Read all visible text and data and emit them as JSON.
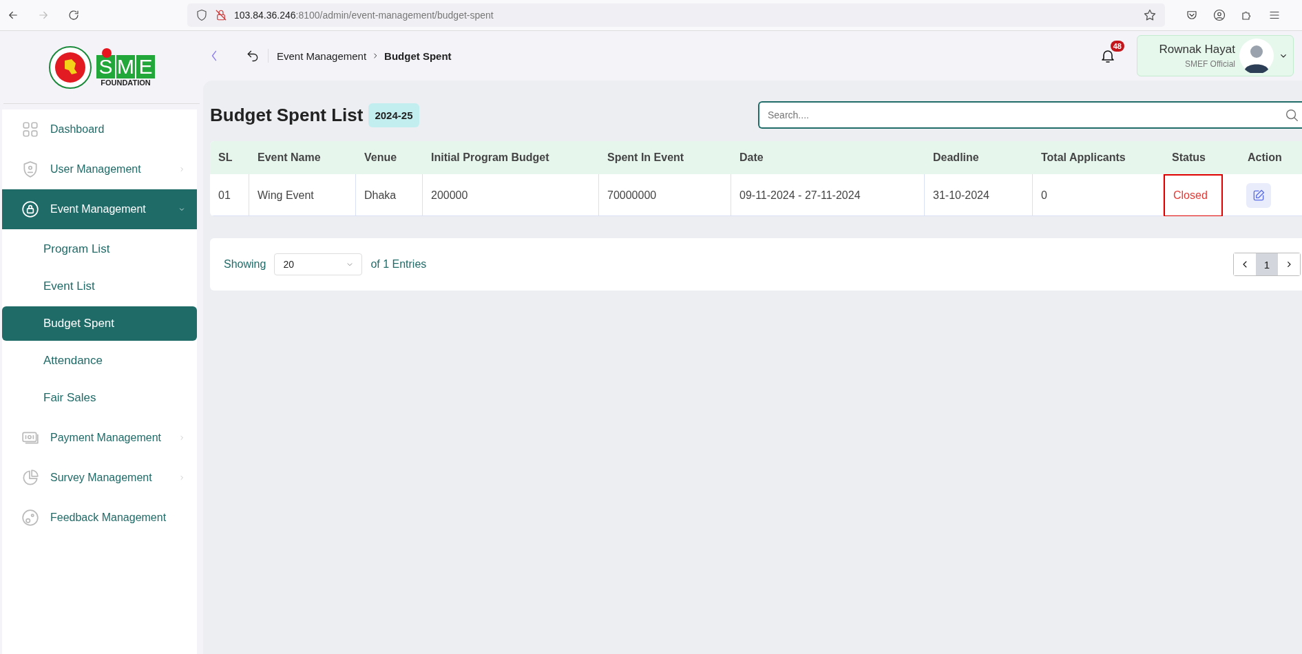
{
  "browser": {
    "url_host": "103.84.36.246",
    "url_path": ":8100/admin/event-management/budget-spent"
  },
  "logo": {
    "letters": [
      "S",
      "M",
      "E"
    ],
    "subtitle": "FOUNDATION"
  },
  "sidebar": {
    "items": [
      {
        "label": "Dashboard",
        "kind": "link",
        "selected": false
      },
      {
        "label": "User Management",
        "kind": "group",
        "selected": false,
        "expanded": false
      },
      {
        "label": "Event Management",
        "kind": "group",
        "selected": true,
        "expanded": true,
        "children": [
          {
            "label": "Program List",
            "selected": false
          },
          {
            "label": "Event List",
            "selected": false
          },
          {
            "label": "Budget Spent",
            "selected": true
          },
          {
            "label": "Attendance",
            "selected": false
          },
          {
            "label": "Fair Sales",
            "selected": false
          }
        ]
      },
      {
        "label": "Payment Management",
        "kind": "group",
        "selected": false,
        "expanded": false
      },
      {
        "label": "Survey Management",
        "kind": "group",
        "selected": false,
        "expanded": false
      },
      {
        "label": "Feedback Management",
        "kind": "link",
        "selected": false
      }
    ]
  },
  "header": {
    "breadcrumb": [
      "Event Management",
      "Budget Spent"
    ],
    "notifications": "48",
    "user": {
      "name": "Rownak Hayat",
      "role": "SMEF Official"
    }
  },
  "page": {
    "title": "Budget Spent List",
    "year_badge": "2024-25",
    "search": {
      "placeholder": "Search...."
    }
  },
  "table": {
    "columns": [
      "SL",
      "Event Name",
      "Venue",
      "Initial Program Budget",
      "Spent In Event",
      "Date",
      "Deadline",
      "Total Applicants",
      "Status",
      "Action"
    ],
    "rows": [
      {
        "cells": [
          "01",
          "Wing Event",
          "Dhaka",
          "200000",
          "70000000",
          "09-11-2024 - 27-11-2024",
          "31-10-2024",
          "0"
        ],
        "status": "Closed",
        "status_highlighted": true
      }
    ]
  },
  "pagination": {
    "showing_label": "Showing",
    "page_size": "20",
    "entries_label": "of 1 Entries",
    "pages": [
      {
        "label": "1",
        "selected": true
      }
    ]
  }
}
